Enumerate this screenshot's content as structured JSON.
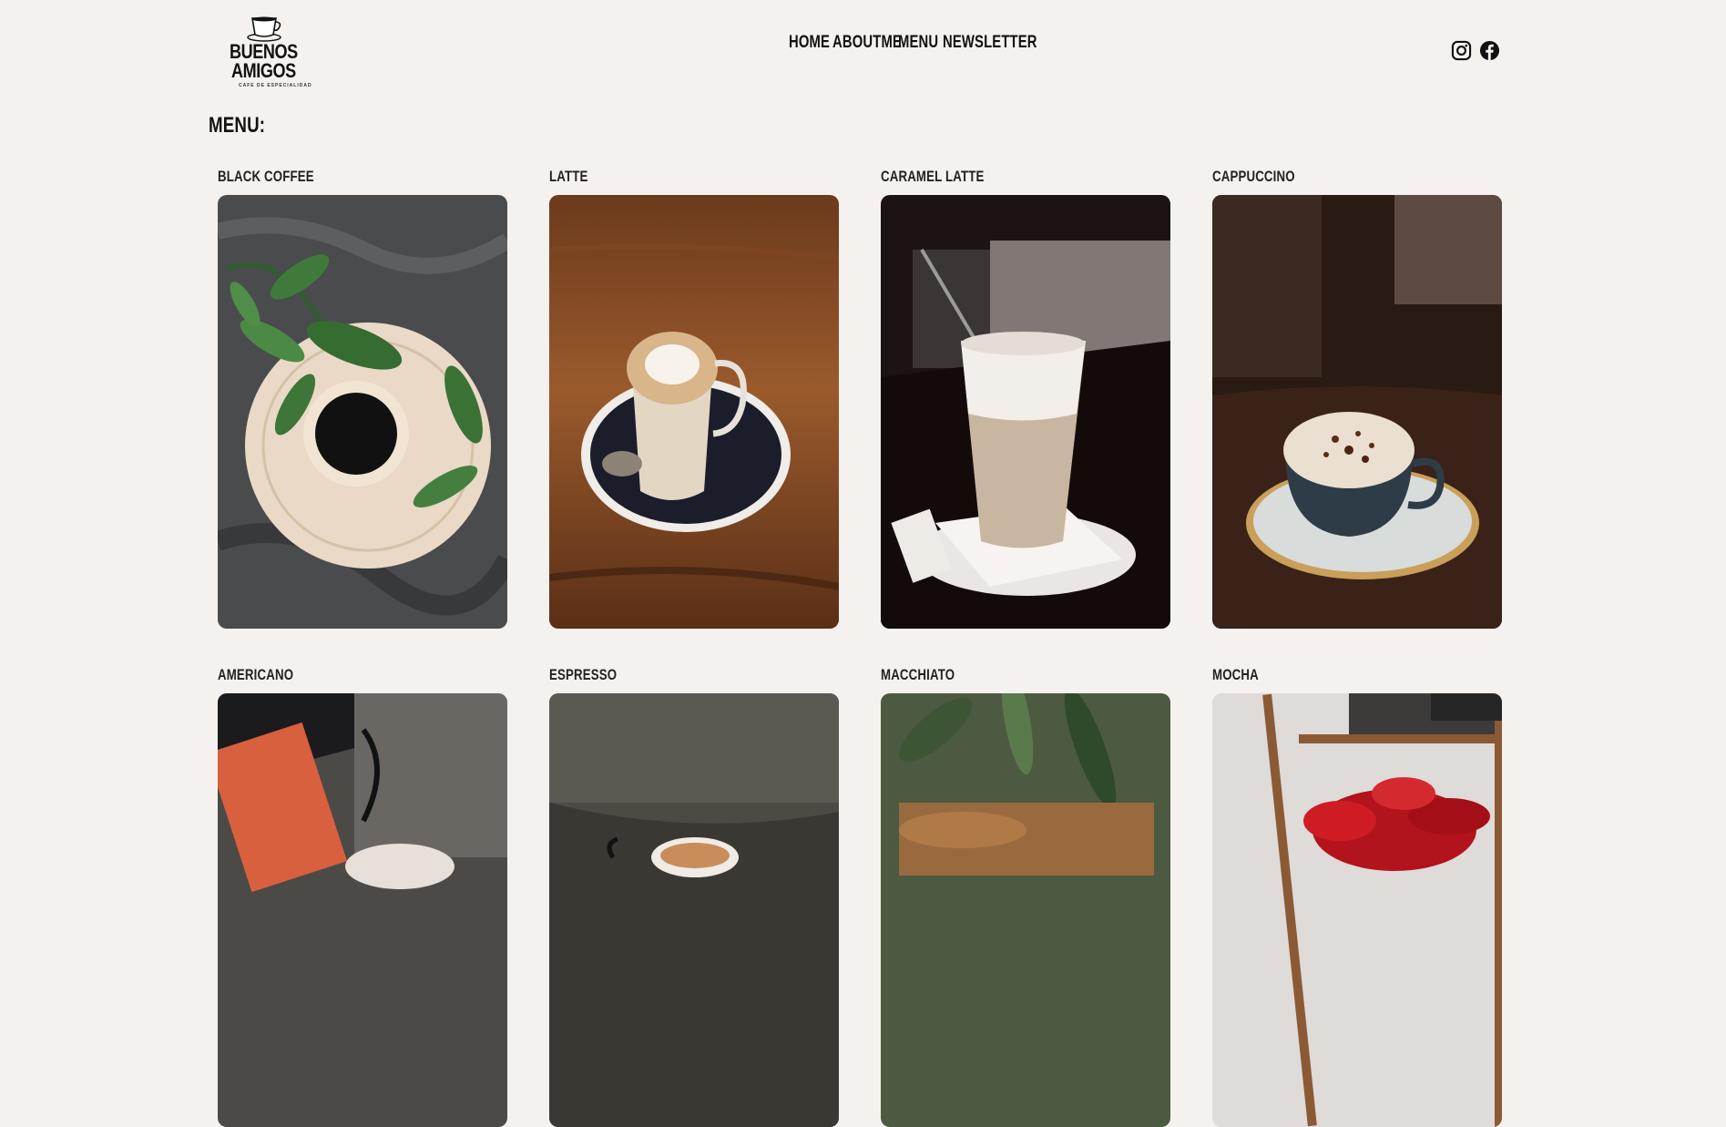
{
  "brand": {
    "name_line1": "BUENOS",
    "name_line2": "AMIGOS",
    "tagline": "CAFE DE ESPECIALIDAD"
  },
  "nav": {
    "home": "HOME",
    "about": "ABOUTME",
    "menu": "MENU",
    "newsletter": "NEWSLETTER"
  },
  "social": {
    "instagram": "instagram-icon",
    "facebook": "facebook-icon"
  },
  "menu": {
    "heading": "MENU:",
    "items": [
      {
        "name": "BLACK COFFEE"
      },
      {
        "name": "LATTE"
      },
      {
        "name": "CARAMEL LATTE"
      },
      {
        "name": "CAPPUCCINO"
      },
      {
        "name": "AMERICANO"
      },
      {
        "name": "ESPRESSO"
      },
      {
        "name": "MACCHIATO"
      },
      {
        "name": "MOCHA"
      }
    ]
  },
  "colors": {
    "background": "#f4f1ef",
    "text": "#111111"
  }
}
